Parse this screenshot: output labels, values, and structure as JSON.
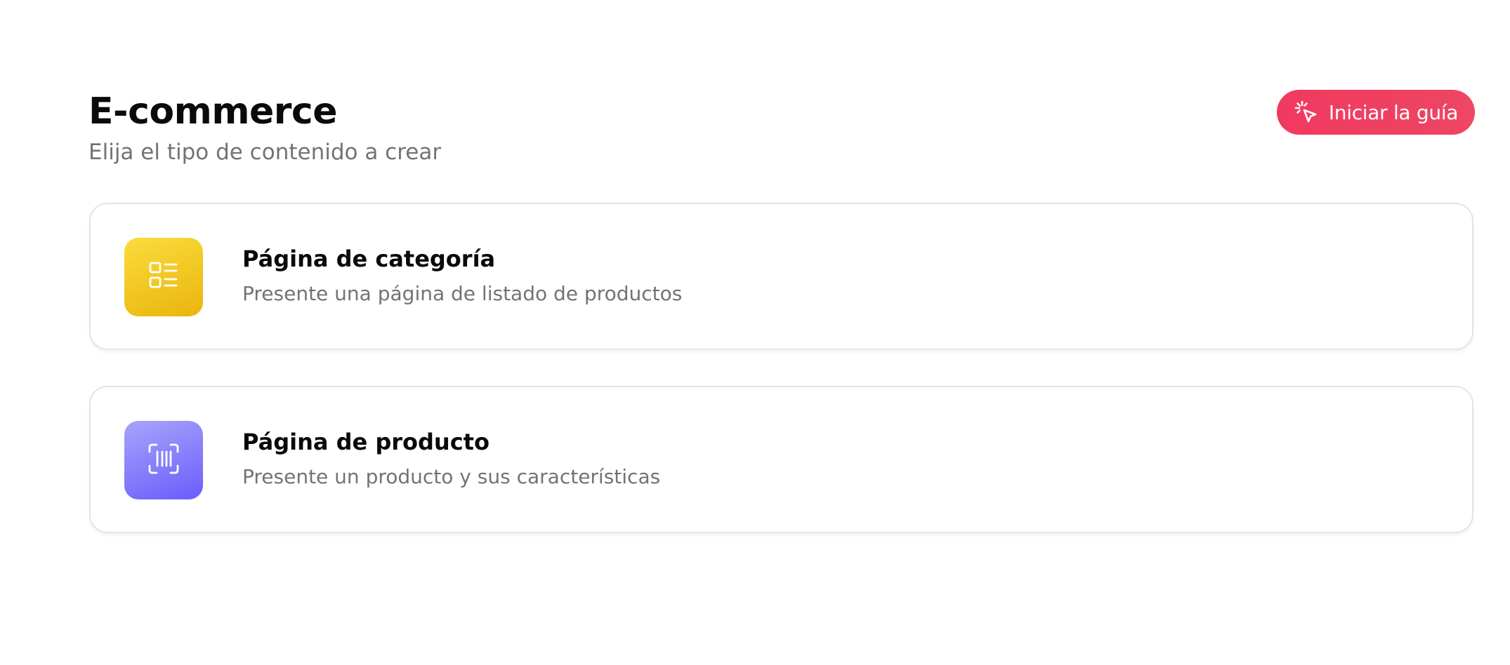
{
  "header": {
    "title": "E-commerce",
    "subtitle": "Elija el tipo de contenido a crear",
    "guide_button": {
      "label": "Iniciar la guía",
      "icon": "cursor-click-icon",
      "color": "#f0395f"
    }
  },
  "options": [
    {
      "title": "Página de categoría",
      "description": "Presente una página de listado de productos",
      "icon": "list-layout-icon",
      "color": "#f5c821"
    },
    {
      "title": "Página de producto",
      "description": "Presente un producto y sus características",
      "icon": "barcode-scan-icon",
      "color": "#7e74fc"
    }
  ]
}
